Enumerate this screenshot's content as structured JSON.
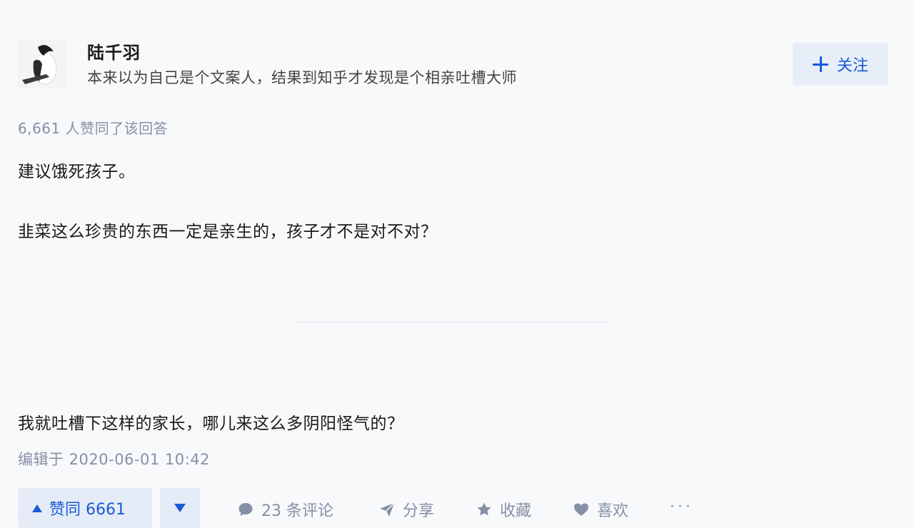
{
  "author": {
    "name": "陆千羽",
    "bio": "本来以为自己是个文案人，结果到知乎才发现是个相亲吐槽大师",
    "follow_label": "关注"
  },
  "answer": {
    "vote_summary": "6,661 人赞同了该回答",
    "paragraphs": [
      "建议饿死孩子。",
      "韭菜这么珍贵的东西一定是亲生的，孩子才不是对不对？",
      "我就吐槽下这样的家长，哪儿来这么多阴阳怪气的？"
    ],
    "edited_time": "编辑于 2020-06-01 10:42"
  },
  "actions": {
    "upvote_label": "赞同 6661",
    "comment_label": "23 条评论",
    "share_label": "分享",
    "collect_label": "收藏",
    "like_label": "喜欢",
    "more_label": "···"
  },
  "colors": {
    "accent": "#1a5ad6",
    "muted": "#8590a6",
    "button_bg": "#e5ecf7"
  }
}
